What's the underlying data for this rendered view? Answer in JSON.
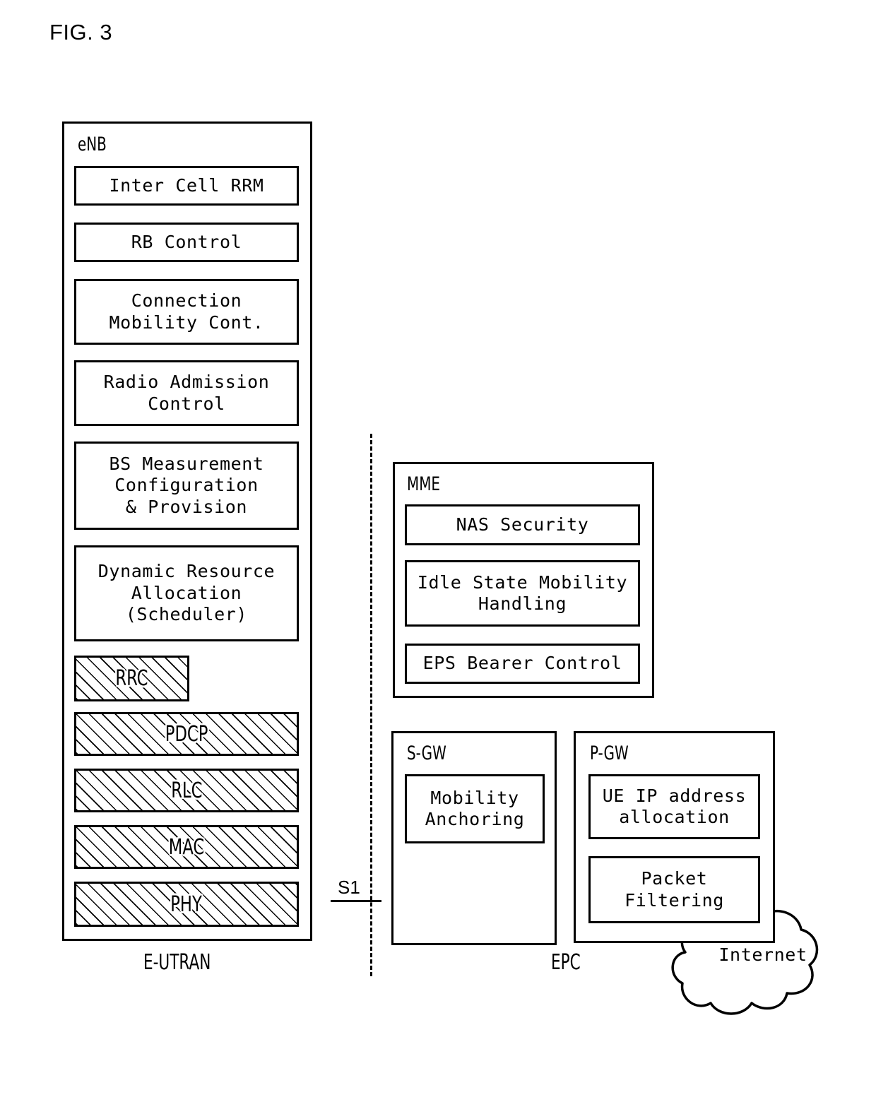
{
  "figure": {
    "title": "FIG. 3",
    "type": "diagram",
    "subject": "LTE EPS functional split between E-UTRAN and EPC"
  },
  "regions": [
    {
      "id": "e-utran",
      "label": "E-UTRAN"
    },
    {
      "id": "epc",
      "label": "EPC"
    }
  ],
  "interface": {
    "label": "S1",
    "style": "dashed-divider"
  },
  "enb": {
    "title": "eNB",
    "functions": [
      {
        "id": "inter-cell-rrm",
        "label": "Inter Cell RRM",
        "hatched": false
      },
      {
        "id": "rb-control",
        "label": "RB Control",
        "hatched": false
      },
      {
        "id": "connection-mobility-cont",
        "label": "Connection\nMobility Cont.",
        "hatched": false
      },
      {
        "id": "radio-admission-control",
        "label": "Radio Admission\nControl",
        "hatched": false
      },
      {
        "id": "bs-measurement",
        "label": "BS Measurement\nConfiguration\n& Provision",
        "hatched": false
      },
      {
        "id": "dynamic-resource-allocation",
        "label": "Dynamic Resource\nAllocation\n(Scheduler)",
        "hatched": false
      }
    ],
    "protocol_stack": [
      {
        "id": "rrc",
        "label": "RRC",
        "hatched": true,
        "half_width": true
      },
      {
        "id": "pdcp",
        "label": "PDCP",
        "hatched": true,
        "half_width": false
      },
      {
        "id": "rlc",
        "label": "RLC",
        "hatched": true,
        "half_width": false
      },
      {
        "id": "mac",
        "label": "MAC",
        "hatched": true,
        "half_width": false
      },
      {
        "id": "phy",
        "label": "PHY",
        "hatched": true,
        "half_width": false
      }
    ]
  },
  "mme": {
    "title": "MME",
    "functions": [
      {
        "id": "nas-security",
        "label": "NAS Security"
      },
      {
        "id": "idle-state-mobility-handling",
        "label": "Idle State Mobility\nHandling"
      },
      {
        "id": "eps-bearer-control",
        "label": "EPS Bearer Control"
      }
    ]
  },
  "sgw": {
    "title": "S-GW",
    "functions": [
      {
        "id": "mobility-anchoring",
        "label": "Mobility\nAnchoring"
      }
    ]
  },
  "pgw": {
    "title": "P-GW",
    "functions": [
      {
        "id": "ue-ip-address-allocation",
        "label": "UE IP address\nallocation"
      },
      {
        "id": "packet-filtering",
        "label": "Packet\nFiltering"
      }
    ]
  },
  "internet": {
    "label": "Internet"
  },
  "colors": {
    "line": "#000000",
    "background": "#ffffff"
  }
}
